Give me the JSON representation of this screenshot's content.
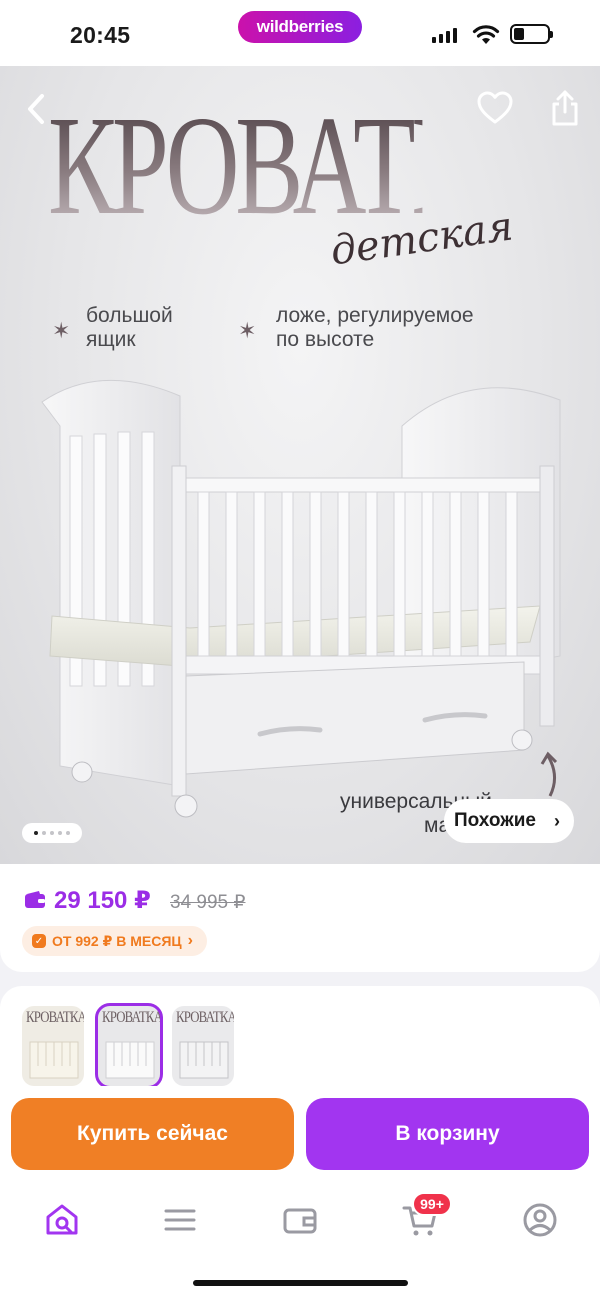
{
  "status_bar": {
    "time": "20:45",
    "app_badge": "wildberries",
    "battery_level": 0.3
  },
  "hero": {
    "headline": "КРОВАТКА",
    "headline_script": "детская",
    "features": [
      {
        "line1": "большой",
        "line2": "ящик"
      },
      {
        "line1": "ложе, регулируемое",
        "line2": "по высоте"
      }
    ],
    "corner_text_line1": "универсальный",
    "corner_text_line2": "ма",
    "similar_label": "Похожие",
    "similar_chevron": "›",
    "gallery": {
      "count": 5,
      "active": 1
    },
    "icons": [
      "back-arrow-icon",
      "heart-icon",
      "share-icon"
    ]
  },
  "price": {
    "current": "29 150 ₽",
    "old": "34 995 ₽",
    "installment": "ОТ 992 ₽ В МЕСЯЦ",
    "installment_chevron": "›",
    "accent_color": "#9b2de6",
    "installment_color": "#f07a1e"
  },
  "variants": {
    "thumbs": [
      {
        "label": "КРОВАТКА",
        "color": "cream",
        "selected": false
      },
      {
        "label": "КРОВАТКА",
        "color": "white",
        "selected": true
      },
      {
        "label": "КРОВАТКА",
        "color": "grey",
        "selected": false
      }
    ]
  },
  "actions": {
    "buy_now": "Купить сейчас",
    "add_to_cart": "В корзину",
    "buy_color": "#f07f25",
    "cart_color": "#a235f0"
  },
  "nav": {
    "items": [
      "home-search-icon",
      "catalog-menu-icon",
      "wallet-icon",
      "cart-icon",
      "profile-icon"
    ],
    "cart_badge": "99+",
    "active": "home-search-icon"
  }
}
